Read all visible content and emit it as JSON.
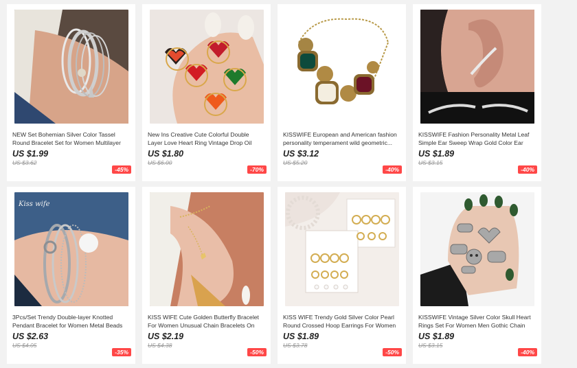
{
  "products": [
    {
      "title": "NEW Set Bohemian Silver Color Tassel Round Bracelet Set for Women Multilayer Pendant...",
      "price": "US $1.99",
      "old_price": "US $3.62",
      "discount": "-45%",
      "image_icon": "bracelet-image"
    },
    {
      "title": "New Ins Creative Cute Colorful Double Layer Love Heart Ring Vintage Drop Oil Metal Heart...",
      "price": "US $1.80",
      "old_price": "US $6.00",
      "discount": "-70%",
      "image_icon": "heart-rings-image"
    },
    {
      "title": "KISSWIFE European and American fashion personality temperament wild geometric...",
      "price": "US $3.12",
      "old_price": "US $5.20",
      "discount": "-40%",
      "image_icon": "necklace-image"
    },
    {
      "title": "KISSWIFE Fashion Personality Metal Leaf Simple Ear Sweep Wrap Gold Color Ear Climber Leafs...",
      "price": "US $1.89",
      "old_price": "US $3.15",
      "discount": "-40%",
      "image_icon": "ear-climber-image"
    },
    {
      "title": "3Pcs/Set Trendy Double-layer Knotted Pendant Bracelet for Women Metal Beads Round Disc...",
      "price": "US $2.63",
      "old_price": "US $4.05",
      "discount": "-35%",
      "image_icon": "knotted-bracelet-image"
    },
    {
      "title": "KISS WIFE Cute Golden Butterfly Bracelet For Women Unusual Chain Bracelets On Hand Ne...",
      "price": "US $2.19",
      "old_price": "US $4.38",
      "discount": "-50%",
      "image_icon": "hand-chain-image"
    },
    {
      "title": "KISS WIFE Trendy Gold Silver Color Pearl Round Crossed Hoop Earrings For Women Small Stu...",
      "price": "US $1.89",
      "old_price": "US $3.78",
      "discount": "-50%",
      "image_icon": "earrings-card-image"
    },
    {
      "title": "KISSWIFE Vintage Silver Color Skull Heart Rings Set For Women Men Gothic Chain Retro Rings...",
      "price": "US $1.89",
      "old_price": "US $3.15",
      "discount": "-40%",
      "image_icon": "skull-rings-image"
    }
  ],
  "watermark": "Kiss wife",
  "colors": {
    "badge": "#ff4747",
    "background": "#f2f2f2"
  }
}
